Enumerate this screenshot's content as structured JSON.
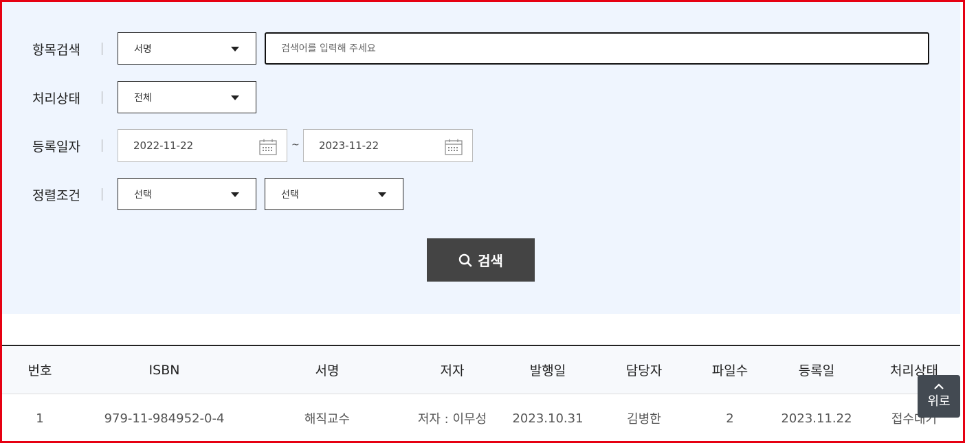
{
  "search": {
    "field_label": "항목검색",
    "field_select": "서명",
    "keyword_placeholder": "검색어를 입력해 주세요",
    "status_label": "처리상태",
    "status_select": "전체",
    "date_label": "등록일자",
    "date_from": "2022-11-22",
    "date_separator": "~",
    "date_to": "2023-11-22",
    "sort_label": "정렬조건",
    "sort_select_1": "선택",
    "sort_select_2": "선택",
    "search_button": "검색"
  },
  "table": {
    "headers": [
      "번호",
      "ISBN",
      "서명",
      "저자",
      "발행일",
      "담당자",
      "파일수",
      "등록일",
      "처리상태"
    ],
    "rows": [
      [
        "1",
        "979-11-984952-0-4",
        "해직교수",
        "저자 : 이무성",
        "2023.10.31",
        "김병한",
        "2",
        "2023.11.22",
        "접수대기"
      ]
    ]
  },
  "top_button": "위로",
  "icons": {
    "dropdown": "caret-down-icon",
    "calendar": "calendar-icon",
    "search": "search-icon",
    "top": "chevron-up-icon"
  }
}
